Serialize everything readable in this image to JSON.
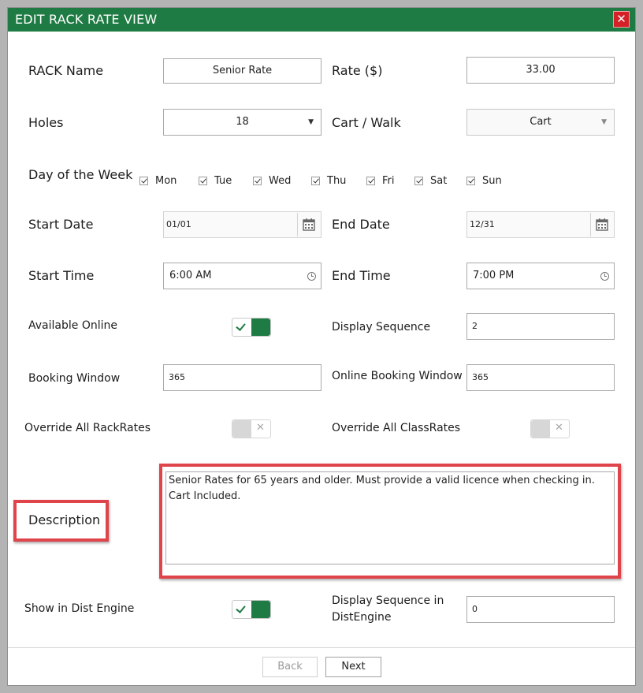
{
  "dialog": {
    "title": "EDIT RACK RATE VIEW",
    "close_glyph": "✕"
  },
  "rack_name": {
    "label": "RACK Name",
    "value": "Senior Rate"
  },
  "rate": {
    "label": "Rate ($)",
    "value": "33.00"
  },
  "holes": {
    "label": "Holes",
    "value": "18"
  },
  "cart_walk": {
    "label": "Cart / Walk",
    "value": "Cart"
  },
  "days": {
    "label": "Day of the Week",
    "items": [
      {
        "label": "Mon",
        "checked": true
      },
      {
        "label": "Tue",
        "checked": true
      },
      {
        "label": "Wed",
        "checked": true
      },
      {
        "label": "Thu",
        "checked": true
      },
      {
        "label": "Fri",
        "checked": true
      },
      {
        "label": "Sat",
        "checked": true
      },
      {
        "label": "Sun",
        "checked": true
      }
    ]
  },
  "start_date": {
    "label": "Start Date",
    "value": "01/01"
  },
  "end_date": {
    "label": "End Date",
    "value": "12/31"
  },
  "start_time": {
    "label": "Start Time",
    "value": "6:00 AM"
  },
  "end_time": {
    "label": "End Time",
    "value": "7:00 PM"
  },
  "available_online": {
    "label": "Available Online",
    "on": true
  },
  "display_sequence": {
    "label": "Display Sequence",
    "value": "2"
  },
  "booking_window": {
    "label": "Booking Window",
    "value": "365"
  },
  "online_booking_window": {
    "label": "Online Booking Window",
    "value": "365"
  },
  "override_rackrates": {
    "label": "Override All RackRates",
    "on": false
  },
  "override_classrates": {
    "label": "Override All ClassRates",
    "on": false
  },
  "description": {
    "label": "Description",
    "line1": "Senior Rates for 65 years and older. Must provide a valid licence when checking in.",
    "line2": "Cart Included."
  },
  "show_in_dist_engine": {
    "label": "Show in Dist Engine",
    "on": true
  },
  "display_sequence_dist": {
    "label_line1": "Display Sequence in",
    "label_line2": "DistEngine",
    "value": "0"
  },
  "footer": {
    "back_label": "Back",
    "next_label": "Next"
  },
  "colors": {
    "brand_green": "#1e7b43",
    "close_red": "#d42027",
    "highlight_red": "#e0444b"
  },
  "icons": {
    "calendar": "calendar-icon",
    "clock": "clock-icon",
    "dropdown": "chevron-down-icon"
  }
}
